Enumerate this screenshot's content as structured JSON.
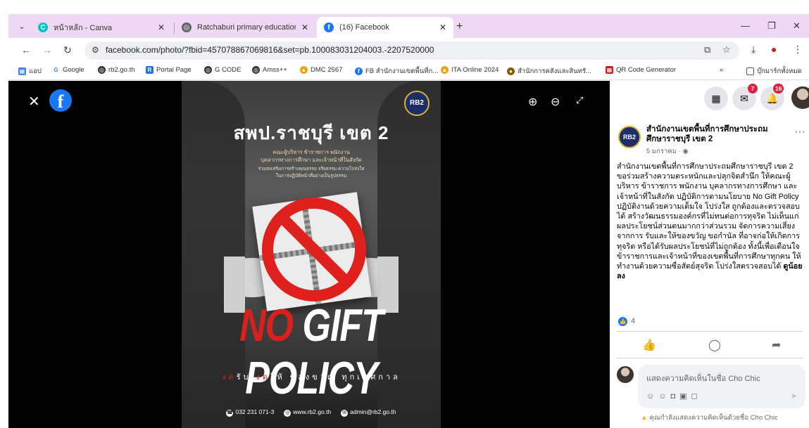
{
  "browser": {
    "tabs": [
      {
        "title": "หน้าหลัก - Canva",
        "icon": "canva-icon",
        "active": false
      },
      {
        "title": "Ratchaburi primary education :",
        "icon": "globe-icon",
        "active": false
      },
      {
        "title": "(16) Facebook",
        "icon": "facebook-icon",
        "active": true
      }
    ],
    "url": "facebook.com/photo/?fbid=457078867069816&set=pb.100083031204003.-2207520000",
    "bookmarks": [
      "แอป",
      "Google",
      "rb2.go.th",
      "Portal Page",
      "G CODE",
      "Amss++",
      "DMC 2567",
      "FB สำนักงานเขตพื้นที่ก...",
      "ITA Online 2024",
      "สำนักการคลังและสินทรั...",
      "QR Code Generator",
      "บุ๊กมาร์กทั้งหมด"
    ],
    "colors": {
      "tab_bar": "#efd8f4",
      "facebook_blue": "#1877f2",
      "notification_red": "#e41e3f"
    }
  },
  "viewer": {
    "poster": {
      "logo_text": "RB2",
      "title": "สพป.ราชบุรี เขต 2",
      "subtitle_lines": [
        "คณะผู้บริหาร ข้าราชการ พนักงาน",
        "บุคลากรทางการศึกษา และเจ้าหน้าที่ในสังกัด",
        "ร่วมส่งเสริมการสร้างคุณธรรม จริยธรรม ความโปร่งใส",
        "ในการปฏิบัติหน้าที่อย่างเป็นรูปธรรม"
      ],
      "headline_no": "NO",
      "headline_rest": "GIFT POLICY",
      "tagline_red1": "งด",
      "tagline_1": "รับ",
      "tagline_red2": "งด",
      "tagline_2": "ให้ ของขวัญ ทุกเทศกาล",
      "phone": "032 231 071-3",
      "website": "www.rb2.go.th",
      "email": "admin@rb2.go.th"
    }
  },
  "panel": {
    "messenger_badge": "7",
    "notifications_badge": "16",
    "post": {
      "author": "สำนักงานเขตพื้นที่การศึกษาประถมศึกษาราชบุรี เขต 2",
      "date": "5 มกราคม · ",
      "body": "สำนักงานเขตพื้นที่การศึกษาประถมศึกษาราชบุรี เขต 2 ขอร่วมสร้างความตระหนักและปลุกจิตสำนึก ให้คณะผู้บริหาร ข้าราชการ พนักงาน บุคลากรทางการศึกษา และเจ้าหน้าที่ในสังกัด ปฏิบัติการตามนโยบาย No Gift Policy ปฏิบัติงานด้วยความเต็มใจ โปร่งใส ถูกต้องและตรวจสอบได้ สร้างวัฒนธรรมองค์กรที่ไม่ทนต่อการทุจริต ไม่เห็นแก่ผลประโยชน์ส่วนตนมากกว่าส่วนรวม จัดการความเสี่ยงจากการ รับและให้ของขวัญ ขอกำนัล ที่อาจก่อให้เกิดการทุจริต หรือได้รับผลประโยชน์ที่ไม่ถูกต้อง ทั้งนี้เพื่อเตือนใจข้าราชการและเจ้าหน้าที่ของเขตพื้นที่การศึกษาทุกคน ให้ทำงานด้วยความซื่อสัตย์สุจริต โปร่งใสตรวจสอบได้ ",
      "body_bold": "ดูน้อยลง",
      "likes": "4"
    },
    "comment": {
      "placeholder": "แสดงความคิดเห็นในชื่อ Cho Chic",
      "notice": "คุณกำลังแสดงความคิดเห็นด้วยชื่อ Cho Chic"
    }
  }
}
